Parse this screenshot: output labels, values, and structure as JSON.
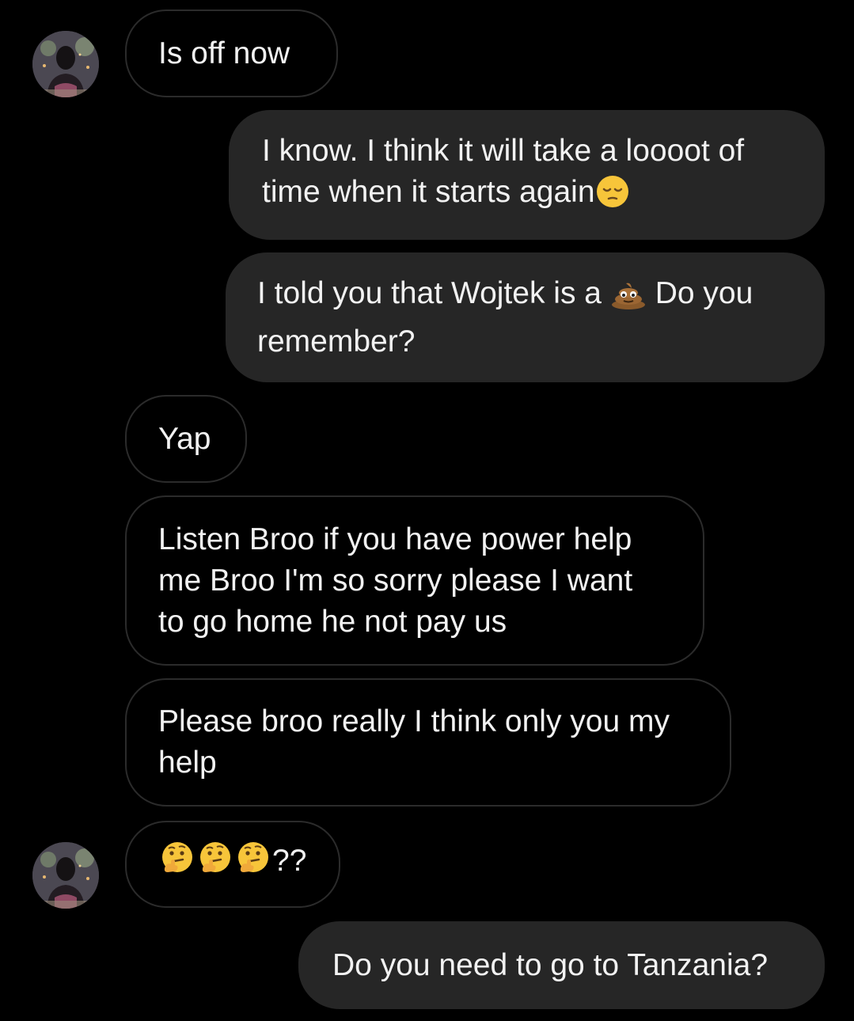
{
  "messages": [
    {
      "id": "m1",
      "direction": "received",
      "text": "Is off now",
      "show_avatar": true
    },
    {
      "id": "m2",
      "direction": "sent",
      "text_line1": "I know. I think it will take a loooot of",
      "text_line2": "time when it starts again",
      "emoji_after": "pensive-face-emoji"
    },
    {
      "id": "m3",
      "direction": "sent",
      "text_before": "I told you that Wojtek is a",
      "emoji": "pile-of-poo-emoji",
      "text_after": "Do you",
      "text_line2": "remember?"
    },
    {
      "id": "m4",
      "direction": "received",
      "text": "Yap"
    },
    {
      "id": "m5",
      "direction": "received",
      "text": "Listen Broo if you have power help me Broo I'm so sorry please I want to go home he not pay us"
    },
    {
      "id": "m6",
      "direction": "received",
      "text": "Please broo really I think only you my help"
    },
    {
      "id": "m7",
      "direction": "received",
      "emojis": [
        "thinking-face-emoji",
        "thinking-face-emoji",
        "thinking-face-emoji"
      ],
      "text": "??",
      "show_avatar": true
    },
    {
      "id": "m8",
      "direction": "sent",
      "text": "Do you need to go to Tanzania?"
    }
  ],
  "colors": {
    "background": "#000000",
    "received_border": "#2b2b2b",
    "sent_background": "#262626",
    "text": "#f2f2f2"
  }
}
